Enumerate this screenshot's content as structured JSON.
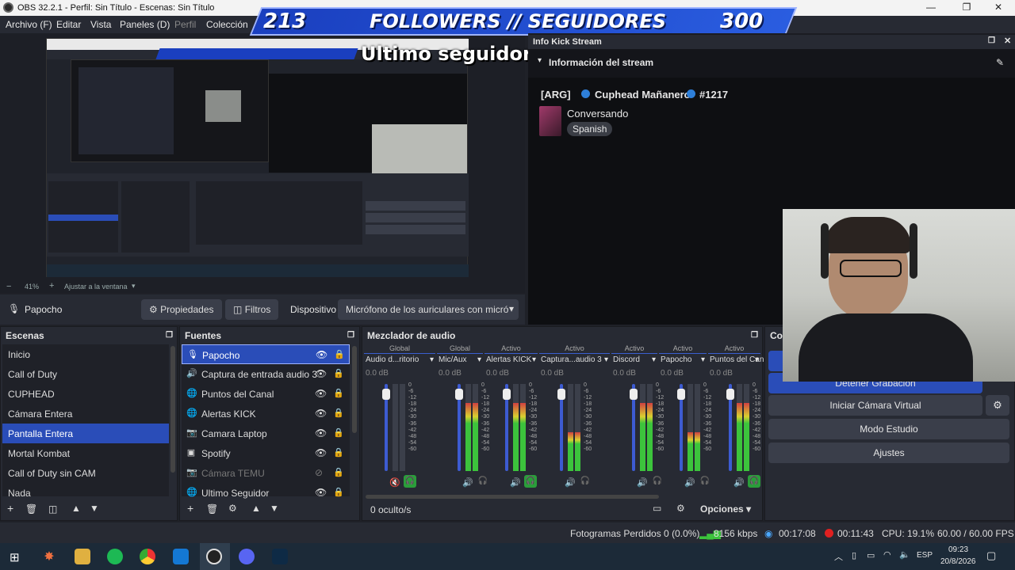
{
  "window": {
    "title": "OBS 32.2.1 - Perfil: Sin Título - Escenas: Sin Título"
  },
  "menu": [
    "Archivo (F)",
    "Editar",
    "Vista",
    "Paneles (D)",
    "Perfil",
    "Colección"
  ],
  "banner": {
    "left_count": "213",
    "text": "FOLLOWERS // SEGUIDORES",
    "right_count": "300",
    "last": "Ultimo seguidor: octamastra"
  },
  "preview": {
    "zoom": "41%",
    "fit": "Ajustar a la ventana"
  },
  "source_toolbar": {
    "name": "Papocho",
    "properties": "Propiedades",
    "filters": "Filtros",
    "device_label": "Dispositivo",
    "device_value": "Micrófono de los auriculares con micró"
  },
  "kick": {
    "dock_title": "Info Kick Stream",
    "sub": "Información del stream",
    "tag": "[ARG]",
    "streamer": "Cuphead Mañanero",
    "rank": "#1217",
    "category": "Conversando",
    "language": "Spanish"
  },
  "scenes": {
    "title": "Escenas",
    "items": [
      "Inicio",
      "Call of Duty",
      "CUPHEAD",
      "Cámara Entera",
      "Pantalla Entera",
      "Mortal Kombat",
      "Call of Duty sin CAM",
      "Nada"
    ],
    "selected": 4
  },
  "sources": {
    "title": "Fuentes",
    "items": [
      {
        "name": "Papocho",
        "icon": "mic-icon",
        "hidden": false
      },
      {
        "name": "Captura de entrada audio 3",
        "icon": "speaker-icon",
        "hidden": false
      },
      {
        "name": "Puntos del Canal",
        "icon": "globe-icon",
        "hidden": false
      },
      {
        "name": "Alertas KICK",
        "icon": "globe-icon",
        "hidden": false
      },
      {
        "name": "Camara Laptop",
        "icon": "camera-icon",
        "hidden": false
      },
      {
        "name": "Spotify",
        "icon": "window-icon",
        "hidden": false
      },
      {
        "name": "Cámara TEMU",
        "icon": "camera-icon",
        "hidden": true
      },
      {
        "name": "Ultimo Seguidor",
        "icon": "globe-icon",
        "hidden": false
      }
    ]
  },
  "mixer": {
    "title": "Mezclador de audio",
    "hidden_count": "0 oculto/s",
    "options": "Opciones",
    "channels": [
      {
        "status": "Global",
        "name": "Audio d...ritorio",
        "db": "0.0 dB",
        "level": 0,
        "fader": 0.95,
        "muted": true
      },
      {
        "status": "Global",
        "name": "Mic/Aux",
        "db": "0.0 dB",
        "level": 0.78,
        "fader": 0.95,
        "muted": false
      },
      {
        "status": "Activo",
        "name": "Alertas KICK",
        "db": "0.0 dB",
        "level": 0.78,
        "fader": 0.95,
        "muted": false
      },
      {
        "status": "Activo",
        "name": "Captura...audio 3",
        "db": "0.0 dB",
        "level": 0.45,
        "fader": 0.95,
        "muted": false
      },
      {
        "status": "Activo",
        "name": "Discord",
        "db": "0.0 dB",
        "level": 0.78,
        "fader": 0.95,
        "muted": false
      },
      {
        "status": "Activo",
        "name": "Papocho",
        "db": "0.0 dB",
        "level": 0.45,
        "fader": 0.95,
        "muted": false
      },
      {
        "status": "Activo",
        "name": "Puntos del Can",
        "db": "0.0 dB",
        "level": 0.78,
        "fader": 0.95,
        "muted": false
      }
    ],
    "scale": [
      "0",
      "-6",
      "-12",
      "-18",
      "-24",
      "-30",
      "-36",
      "-42",
      "-48",
      "-54",
      "-60"
    ]
  },
  "controls": {
    "title": "Co",
    "stop_rec": "Detener Grabación",
    "virtual_cam": "Iniciar Cámara Virtual",
    "studio": "Modo Estudio",
    "settings": "Ajustes"
  },
  "status": {
    "frames": "Fotogramas Perdidos 0 (0.0%)",
    "kbps": "8156 kbps",
    "stream_time": "00:17:08",
    "rec_time": "00:11:43",
    "cpu": "CPU: 19.1%",
    "fps": "60.00 / 60.00 FPS"
  },
  "taskbar": {
    "lang": "ESP",
    "time": "09:23",
    "date": "20/8/2026"
  },
  "colors": {
    "accent": "#2a4db8",
    "banner": "#1a3fbf",
    "bg": "#272a33"
  }
}
